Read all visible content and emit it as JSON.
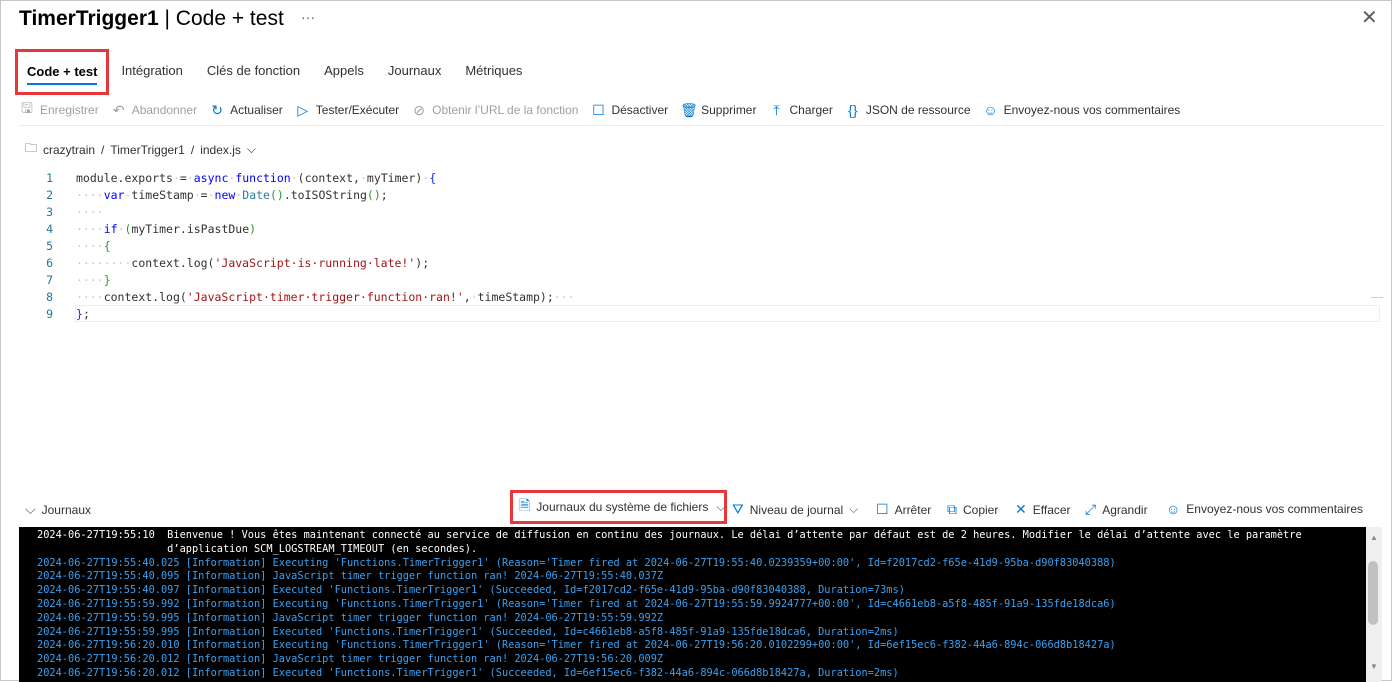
{
  "header": {
    "title_main": "TimerTrigger1",
    "title_sep": " | ",
    "title_sub": "Code + test",
    "more": "···",
    "close": "✕"
  },
  "tabs": [
    {
      "label": "Code + test",
      "active": true
    },
    {
      "label": "Intégration"
    },
    {
      "label": "Clés de fonction"
    },
    {
      "label": "Appels"
    },
    {
      "label": "Journaux"
    },
    {
      "label": "Métriques"
    }
  ],
  "toolbar": [
    {
      "label": "Enregistrer",
      "icon": "save-icon",
      "glyph": "🖫",
      "disabled": true
    },
    {
      "label": "Abandonner",
      "icon": "undo-icon",
      "glyph": "↶",
      "disabled": true
    },
    {
      "label": "Actualiser",
      "icon": "refresh-icon",
      "glyph": "↻"
    },
    {
      "label": "Tester/Exécuter",
      "icon": "play-icon",
      "glyph": "▷"
    },
    {
      "label": "Obtenir l’URL de la fonction",
      "icon": "link-icon",
      "glyph": "⊘",
      "disabled": true
    },
    {
      "label": "Désactiver",
      "icon": "stop-icon",
      "glyph": "☐"
    },
    {
      "label": "Supprimer",
      "icon": "trash-icon",
      "glyph": "🗑"
    },
    {
      "label": "Charger",
      "icon": "upload-icon",
      "glyph": "⤒"
    },
    {
      "label": "JSON de ressource",
      "icon": "json-icon",
      "glyph": "{}"
    },
    {
      "label": "Envoyez-nous vos commentaires",
      "icon": "feedback-icon",
      "glyph": "☺"
    }
  ],
  "breadcrumb": {
    "items": [
      "crazytrain",
      "TimerTrigger1",
      "index.js"
    ],
    "sep": "/"
  },
  "code": [
    [
      [
        "",
        "module.exports"
      ],
      [
        "ws",
        "·"
      ],
      [
        "",
        "="
      ],
      [
        "ws",
        "·"
      ],
      [
        "kw",
        "async"
      ],
      [
        "ws",
        "·"
      ],
      [
        "kw",
        "function"
      ],
      [
        "ws",
        "·"
      ],
      [
        "",
        "(context,"
      ],
      [
        "ws",
        "·"
      ],
      [
        "",
        "myTimer)"
      ],
      [
        "ws",
        "·"
      ],
      [
        "br2",
        "{"
      ]
    ],
    [
      [
        "ws",
        "····"
      ],
      [
        "kw",
        "var"
      ],
      [
        "ws",
        "·"
      ],
      [
        "",
        "timeStamp"
      ],
      [
        "ws",
        "·"
      ],
      [
        "",
        "="
      ],
      [
        "ws",
        "·"
      ],
      [
        "kw",
        "new"
      ],
      [
        "ws",
        "·"
      ],
      [
        "fn",
        "Date"
      ],
      [
        "br",
        "()"
      ],
      [
        "",
        ".toISOString"
      ],
      [
        "br",
        "()"
      ],
      [
        "",
        ";"
      ]
    ],
    [
      [
        "ws",
        "····"
      ]
    ],
    [
      [
        "ws",
        "····"
      ],
      [
        "kw",
        "if"
      ],
      [
        "ws",
        "·"
      ],
      [
        "br",
        "("
      ],
      [
        "",
        "myTimer.isPastDue"
      ],
      [
        "br",
        ")"
      ]
    ],
    [
      [
        "ws",
        "····"
      ],
      [
        "br",
        "{"
      ]
    ],
    [
      [
        "ws",
        "········"
      ],
      [
        "",
        "context.log("
      ],
      [
        "str",
        "'JavaScript·is·running·late!'"
      ],
      [
        "",
        ");"
      ]
    ],
    [
      [
        "ws",
        "····"
      ],
      [
        "br",
        "}"
      ]
    ],
    [
      [
        "ws",
        "····"
      ],
      [
        "",
        "context.log("
      ],
      [
        "str",
        "'JavaScript·timer·trigger·function·ran!'"
      ],
      [
        "",
        ","
      ],
      [
        "ws",
        "·"
      ],
      [
        "",
        "timeStamp);"
      ],
      [
        "ws",
        "···"
      ]
    ],
    [
      [
        "br2",
        "}"
      ],
      [
        "",
        ";"
      ]
    ]
  ],
  "logs_bar": {
    "toggle": "Journaux",
    "source": "Journaux du système de fichiers",
    "level": "Niveau de journal",
    "stop": "Arrêter",
    "copy": "Copier",
    "clear": "Effacer",
    "expand": "Agrandir",
    "feedback": "Envoyez-nous vos commentaires"
  },
  "console": [
    {
      "text": "2024-06-27T19:55:10  Bienvenue ! Vous êtes maintenant connecté au service de diffusion en continu des journaux. Le délai d’attente par défaut est de 2 heures. Modifier le délai d’attente avec le paramètre",
      "white": true
    },
    {
      "text": "                     d’application SCM_LOGSTREAM_TIMEOUT (en secondes).",
      "white": true
    },
    {
      "text": "2024-06-27T19:55:40.025 [Information] Executing 'Functions.TimerTrigger1' (Reason='Timer fired at 2024-06-27T19:55:40.0239359+00:00', Id=f2017cd2-f65e-41d9-95ba-d90f83040388)"
    },
    {
      "text": "2024-06-27T19:55:40.095 [Information] JavaScript timer trigger function ran! 2024-06-27T19:55:40.037Z"
    },
    {
      "text": "2024-06-27T19:55:40.097 [Information] Executed 'Functions.TimerTrigger1' (Succeeded, Id=f2017cd2-f65e-41d9-95ba-d90f83040388, Duration=73ms)"
    },
    {
      "text": "2024-06-27T19:55:59.992 [Information] Executing 'Functions.TimerTrigger1' (Reason='Timer fired at 2024-06-27T19:55:59.9924777+00:00', Id=c4661eb8-a5f8-485f-91a9-135fde18dca6)"
    },
    {
      "text": "2024-06-27T19:55:59.995 [Information] JavaScript timer trigger function ran! 2024-06-27T19:55:59.992Z"
    },
    {
      "text": "2024-06-27T19:55:59.995 [Information] Executed 'Functions.TimerTrigger1' (Succeeded, Id=c4661eb8-a5f8-485f-91a9-135fde18dca6, Duration=2ms)"
    },
    {
      "text": "2024-06-27T19:56:20.010 [Information] Executing 'Functions.TimerTrigger1' (Reason='Timer fired at 2024-06-27T19:56:20.0102299+00:00', Id=6ef15ec6-f382-44a6-894c-066d8b18427a)"
    },
    {
      "text": "2024-06-27T19:56:20.012 [Information] JavaScript timer trigger function ran! 2024-06-27T19:56:20.009Z"
    },
    {
      "text": "2024-06-27T19:56:20.012 [Information] Executed 'Functions.TimerTrigger1' (Succeeded, Id=6ef15ec6-f382-44a6-894c-066d8b18427a, Duration=2ms)"
    }
  ],
  "colors": {
    "accent": "#0078d4",
    "highlight": "#e8363b",
    "console_bg": "#000000",
    "console_text": "#3aa0f0"
  }
}
